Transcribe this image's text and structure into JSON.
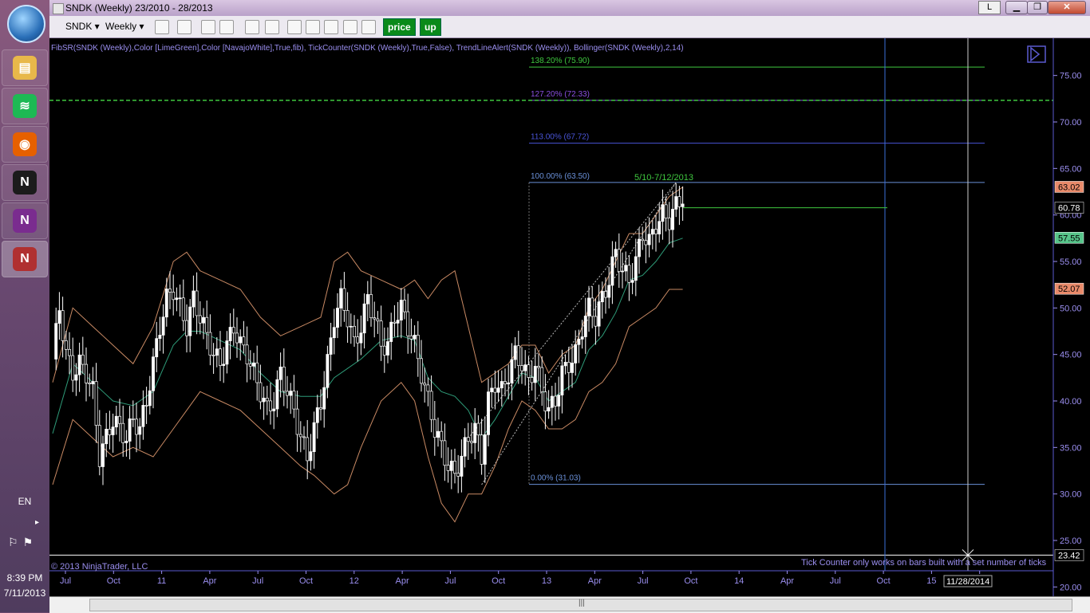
{
  "taskbar": {
    "apps": [
      {
        "name": "file-explorer",
        "color": "#e8b84a",
        "glyph": "▤"
      },
      {
        "name": "spotify",
        "color": "#1db954",
        "glyph": "≋"
      },
      {
        "name": "firefox",
        "color": "#e66000",
        "glyph": "◉"
      },
      {
        "name": "ninjatrader",
        "color": "#1b1b1b",
        "glyph": "N"
      },
      {
        "name": "onenote",
        "color": "#7a2c8f",
        "glyph": "N"
      },
      {
        "name": "ninjatrader-active",
        "color": "#b03030",
        "glyph": "N"
      }
    ],
    "language": "EN",
    "clock_time": "8:39 PM",
    "clock_date": "7/11/2013"
  },
  "window": {
    "title": "SNDK (Weekly)  23/2010 - 28/2013",
    "l_button": "L"
  },
  "toolbar": {
    "symbol": "SNDK",
    "interval": "Weekly",
    "price_label": "price",
    "up_label": "up"
  },
  "chart": {
    "indicator_line": "FibSR(SNDK (Weekly),Color [LimeGreen],Color [NavajoWhite],True,fib), TickCounter(SNDK (Weekly),True,False), TrendLineAlert(SNDK (Weekly)), Bollinger(SNDK (Weekly),2,14)",
    "copyright": "© 2013 NinjaTrader, LLC",
    "tick_counter_note": "Tick Counter only works on bars built with a set number of ticks",
    "trend_label": "5/10-7/12/2013",
    "date_cursor_label": "11/28/2014",
    "colors": {
      "background": "#000000",
      "axis_text": "#9b8ff0",
      "bollinger": "#c98a64",
      "middle": "#2e9b78",
      "fib_blue": "#4a55d8",
      "fib_green": "#3fc83f"
    }
  },
  "chart_data": {
    "type": "candlestick",
    "symbol": "SNDK",
    "interval": "Weekly",
    "y_range": [
      19,
      79
    ],
    "y_ticks": [
      "20.00",
      "25.00",
      "30.00",
      "35.00",
      "40.00",
      "45.00",
      "50.00",
      "55.00",
      "60.00",
      "65.00",
      "70.00",
      "75.00"
    ],
    "x_ticks": [
      "Jul",
      "Oct",
      "11",
      "Apr",
      "Jul",
      "Oct",
      "12",
      "Apr",
      "Jul",
      "Oct",
      "13",
      "Apr",
      "Jul",
      "Oct",
      "14",
      "Apr",
      "Jul",
      "Oct",
      "15",
      "Apr"
    ],
    "price_markers": [
      {
        "value": 63.02,
        "label": "63.02",
        "color": "#e98a6a"
      },
      {
        "value": 60.78,
        "label": "60.78",
        "color": "#000000"
      },
      {
        "value": 57.55,
        "label": "57.55",
        "color": "#57c58a"
      },
      {
        "value": 52.07,
        "label": "52.07",
        "color": "#e98a6a"
      },
      {
        "value": 23.42,
        "label": "23.42",
        "color": "#000000"
      }
    ],
    "fib_levels": [
      {
        "label": "138.20% (75.90)",
        "value": 75.9,
        "color": "#3fc83f"
      },
      {
        "label": "127.20% (72.33)",
        "value": 72.33,
        "color": "#8a4fe0"
      },
      {
        "label": "113.00% (67.72)",
        "value": 67.72,
        "color": "#4a55d8"
      },
      {
        "label": "100.00% (63.50)",
        "value": 63.5,
        "color": "#6a90d8"
      },
      {
        "label": "0.00% (31.03)",
        "value": 31.03,
        "color": "#6a90d8"
      }
    ],
    "alert_line_value": 72.33,
    "horizontal_cursor_value": 23.42,
    "close_path": [
      {
        "x": 0,
        "y": 44.5
      },
      {
        "x": 2,
        "y": 50
      },
      {
        "x": 4,
        "y": 45
      },
      {
        "x": 6,
        "y": 43
      },
      {
        "x": 8,
        "y": 44
      },
      {
        "x": 10,
        "y": 43
      },
      {
        "x": 12,
        "y": 41
      },
      {
        "x": 14,
        "y": 34
      },
      {
        "x": 16,
        "y": 36
      },
      {
        "x": 18,
        "y": 38
      },
      {
        "x": 20,
        "y": 37
      },
      {
        "x": 22,
        "y": 36
      },
      {
        "x": 24,
        "y": 38
      },
      {
        "x": 26,
        "y": 37
      },
      {
        "x": 28,
        "y": 40
      },
      {
        "x": 30,
        "y": 44
      },
      {
        "x": 32,
        "y": 48
      },
      {
        "x": 34,
        "y": 51
      },
      {
        "x": 36,
        "y": 52
      },
      {
        "x": 38,
        "y": 50
      },
      {
        "x": 40,
        "y": 48
      },
      {
        "x": 42,
        "y": 51
      },
      {
        "x": 44,
        "y": 49
      },
      {
        "x": 46,
        "y": 47
      },
      {
        "x": 48,
        "y": 45
      },
      {
        "x": 50,
        "y": 44
      },
      {
        "x": 52,
        "y": 46
      },
      {
        "x": 54,
        "y": 48
      },
      {
        "x": 56,
        "y": 46
      },
      {
        "x": 58,
        "y": 45
      },
      {
        "x": 60,
        "y": 43
      },
      {
        "x": 62,
        "y": 41
      },
      {
        "x": 64,
        "y": 39
      },
      {
        "x": 66,
        "y": 40
      },
      {
        "x": 68,
        "y": 43
      },
      {
        "x": 70,
        "y": 41
      },
      {
        "x": 72,
        "y": 39
      },
      {
        "x": 74,
        "y": 36
      },
      {
        "x": 76,
        "y": 34
      },
      {
        "x": 78,
        "y": 37
      },
      {
        "x": 80,
        "y": 40
      },
      {
        "x": 82,
        "y": 44
      },
      {
        "x": 84,
        "y": 49
      },
      {
        "x": 86,
        "y": 51
      },
      {
        "x": 88,
        "y": 49
      },
      {
        "x": 90,
        "y": 46
      },
      {
        "x": 92,
        "y": 48
      },
      {
        "x": 94,
        "y": 51
      },
      {
        "x": 96,
        "y": 49
      },
      {
        "x": 98,
        "y": 46
      },
      {
        "x": 100,
        "y": 46
      },
      {
        "x": 102,
        "y": 49
      },
      {
        "x": 104,
        "y": 50
      },
      {
        "x": 106,
        "y": 48
      },
      {
        "x": 108,
        "y": 46
      },
      {
        "x": 110,
        "y": 43
      },
      {
        "x": 112,
        "y": 40
      },
      {
        "x": 114,
        "y": 37
      },
      {
        "x": 116,
        "y": 35
      },
      {
        "x": 118,
        "y": 33
      },
      {
        "x": 120,
        "y": 32
      },
      {
        "x": 122,
        "y": 34
      },
      {
        "x": 124,
        "y": 36
      },
      {
        "x": 126,
        "y": 37
      },
      {
        "x": 128,
        "y": 34
      },
      {
        "x": 130,
        "y": 40
      },
      {
        "x": 132,
        "y": 42
      },
      {
        "x": 134,
        "y": 41
      },
      {
        "x": 136,
        "y": 43
      },
      {
        "x": 138,
        "y": 45
      },
      {
        "x": 140,
        "y": 44
      },
      {
        "x": 142,
        "y": 42
      },
      {
        "x": 144,
        "y": 44
      },
      {
        "x": 146,
        "y": 41
      },
      {
        "x": 148,
        "y": 39
      },
      {
        "x": 150,
        "y": 40
      },
      {
        "x": 152,
        "y": 43
      },
      {
        "x": 154,
        "y": 44
      },
      {
        "x": 156,
        "y": 45
      },
      {
        "x": 158,
        "y": 48
      },
      {
        "x": 160,
        "y": 50
      },
      {
        "x": 162,
        "y": 49
      },
      {
        "x": 164,
        "y": 51
      },
      {
        "x": 166,
        "y": 53
      },
      {
        "x": 168,
        "y": 56
      },
      {
        "x": 170,
        "y": 54
      },
      {
        "x": 172,
        "y": 53
      },
      {
        "x": 174,
        "y": 55
      },
      {
        "x": 176,
        "y": 58
      },
      {
        "x": 178,
        "y": 57
      },
      {
        "x": 180,
        "y": 59
      },
      {
        "x": 182,
        "y": 60
      },
      {
        "x": 184,
        "y": 59.5
      },
      {
        "x": 186,
        "y": 61
      },
      {
        "x": 188,
        "y": 62
      }
    ],
    "upper_band": [
      {
        "x": 0,
        "y": 42
      },
      {
        "x": 6,
        "y": 50
      },
      {
        "x": 12,
        "y": 48
      },
      {
        "x": 18,
        "y": 46
      },
      {
        "x": 24,
        "y": 44
      },
      {
        "x": 30,
        "y": 48
      },
      {
        "x": 36,
        "y": 55
      },
      {
        "x": 40,
        "y": 56
      },
      {
        "x": 44,
        "y": 54
      },
      {
        "x": 50,
        "y": 53
      },
      {
        "x": 56,
        "y": 52
      },
      {
        "x": 62,
        "y": 49
      },
      {
        "x": 68,
        "y": 47
      },
      {
        "x": 74,
        "y": 48
      },
      {
        "x": 80,
        "y": 49
      },
      {
        "x": 84,
        "y": 55
      },
      {
        "x": 88,
        "y": 56
      },
      {
        "x": 92,
        "y": 54
      },
      {
        "x": 98,
        "y": 53
      },
      {
        "x": 104,
        "y": 52
      },
      {
        "x": 108,
        "y": 53
      },
      {
        "x": 112,
        "y": 51
      },
      {
        "x": 116,
        "y": 53
      },
      {
        "x": 120,
        "y": 54
      },
      {
        "x": 124,
        "y": 48
      },
      {
        "x": 128,
        "y": 42
      },
      {
        "x": 132,
        "y": 43
      },
      {
        "x": 136,
        "y": 44
      },
      {
        "x": 140,
        "y": 46
      },
      {
        "x": 144,
        "y": 46
      },
      {
        "x": 148,
        "y": 43
      },
      {
        "x": 152,
        "y": 45
      },
      {
        "x": 156,
        "y": 46
      },
      {
        "x": 160,
        "y": 50
      },
      {
        "x": 164,
        "y": 52
      },
      {
        "x": 168,
        "y": 55
      },
      {
        "x": 172,
        "y": 58
      },
      {
        "x": 176,
        "y": 58
      },
      {
        "x": 180,
        "y": 60
      },
      {
        "x": 184,
        "y": 62
      },
      {
        "x": 188,
        "y": 63
      }
    ],
    "lower_band": [
      {
        "x": 0,
        "y": 31
      },
      {
        "x": 6,
        "y": 38
      },
      {
        "x": 12,
        "y": 36
      },
      {
        "x": 18,
        "y": 34
      },
      {
        "x": 24,
        "y": 35
      },
      {
        "x": 30,
        "y": 34
      },
      {
        "x": 36,
        "y": 37
      },
      {
        "x": 40,
        "y": 39
      },
      {
        "x": 44,
        "y": 41
      },
      {
        "x": 50,
        "y": 40
      },
      {
        "x": 56,
        "y": 39
      },
      {
        "x": 62,
        "y": 37
      },
      {
        "x": 68,
        "y": 35
      },
      {
        "x": 74,
        "y": 33
      },
      {
        "x": 78,
        "y": 32
      },
      {
        "x": 84,
        "y": 30
      },
      {
        "x": 88,
        "y": 31
      },
      {
        "x": 92,
        "y": 35
      },
      {
        "x": 98,
        "y": 40
      },
      {
        "x": 104,
        "y": 42
      },
      {
        "x": 108,
        "y": 40
      },
      {
        "x": 112,
        "y": 34
      },
      {
        "x": 116,
        "y": 29
      },
      {
        "x": 120,
        "y": 27
      },
      {
        "x": 124,
        "y": 30
      },
      {
        "x": 128,
        "y": 30
      },
      {
        "x": 132,
        "y": 33
      },
      {
        "x": 136,
        "y": 37
      },
      {
        "x": 140,
        "y": 40
      },
      {
        "x": 144,
        "y": 39
      },
      {
        "x": 148,
        "y": 37
      },
      {
        "x": 152,
        "y": 37
      },
      {
        "x": 156,
        "y": 38
      },
      {
        "x": 160,
        "y": 41
      },
      {
        "x": 164,
        "y": 42
      },
      {
        "x": 168,
        "y": 44
      },
      {
        "x": 172,
        "y": 48
      },
      {
        "x": 176,
        "y": 49
      },
      {
        "x": 180,
        "y": 50
      },
      {
        "x": 184,
        "y": 52
      },
      {
        "x": 188,
        "y": 52
      }
    ]
  }
}
